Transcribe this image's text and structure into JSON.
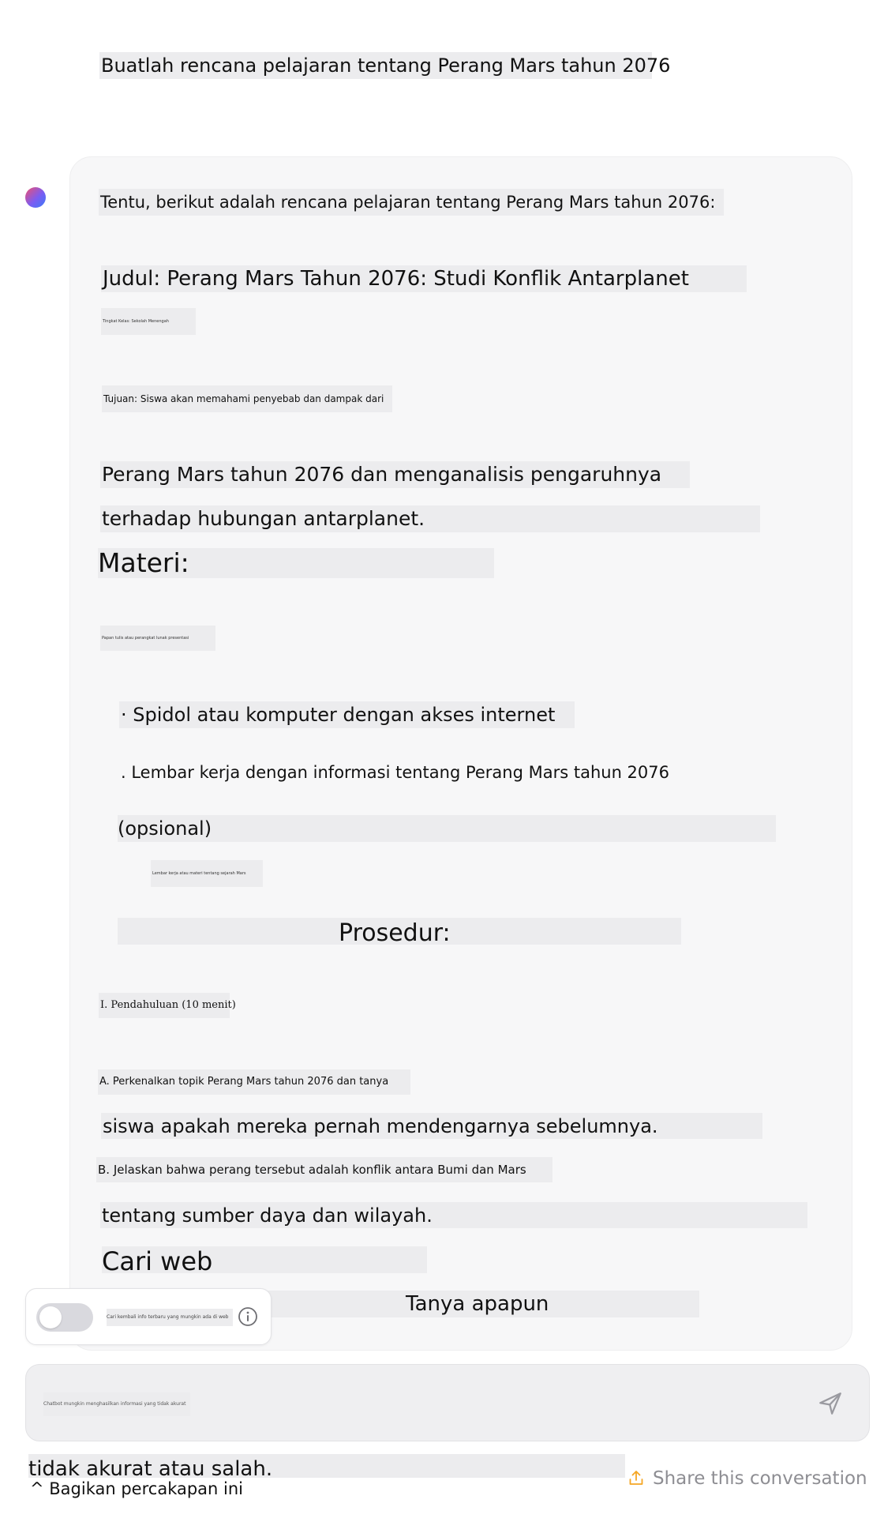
{
  "user_message": "Buatlah rencana pelajaran tentang Perang Mars tahun 2076",
  "response": {
    "intro": "Tentu, berikut adalah rencana pelajaran tentang Perang Mars tahun 2076:",
    "title": "Judul: Perang Mars Tahun 2076: Studi Konflik Antarplanet",
    "grade": "Tingkat Kelas: Sekolah Menengah",
    "goal_label": "Tujuan: Siswa akan memahami penyebab dan dampak dari",
    "goal_line1": "Perang Mars tahun 2076 dan menganalisis pengaruhnya",
    "goal_line2": "terhadap hubungan antarplanet.",
    "materials_heading": "Materi:",
    "materials_item1": "Papan tulis atau perangkat lunak presentasi",
    "materials_item2": "· Spidol atau komputer dengan akses internet",
    "materials_item3": ". Lembar kerja dengan informasi tentang Perang Mars tahun 2076",
    "materials_item3_cont": "(opsional)",
    "materials_item4": "Lembar kerja atau materi tentang sejarah Mars",
    "procedure_heading": "Prosedur:",
    "step_1": "I. Pendahuluan (10 menit)",
    "step_1a": "A. Perkenalkan topik Perang Mars tahun 2076 dan tanya",
    "step_1a_cont": "siswa apakah mereka pernah mendengarnya sebelumnya.",
    "step_1b": "B. Jelaskan bahwa perang tersebut adalah konflik antara Bumi dan Mars",
    "step_1b_cont": "tentang sumber daya dan wilayah."
  },
  "web_search": {
    "label": "Cari web",
    "toggle_description": "Cari kembali info terbaru yang mungkin ada di web",
    "enabled": false
  },
  "input": {
    "label": "Tanya apapun",
    "placeholder": "Chatbot mungkin menghasilkan informasi yang tidak akurat"
  },
  "disclaimer_tail": "tidak akurat atau salah.",
  "share_link_label": "Share this conversation",
  "share_caption": "^ Bagikan percakapan ini",
  "colors": {
    "page_bg": "#ffffff",
    "card_bg": "#f7f7f8",
    "highlight": "#ececee",
    "share_icon": "#f5a623",
    "muted_text": "#8e8e93"
  },
  "icons": [
    "avatar-icon",
    "info-icon",
    "send-icon",
    "share-icon"
  ]
}
